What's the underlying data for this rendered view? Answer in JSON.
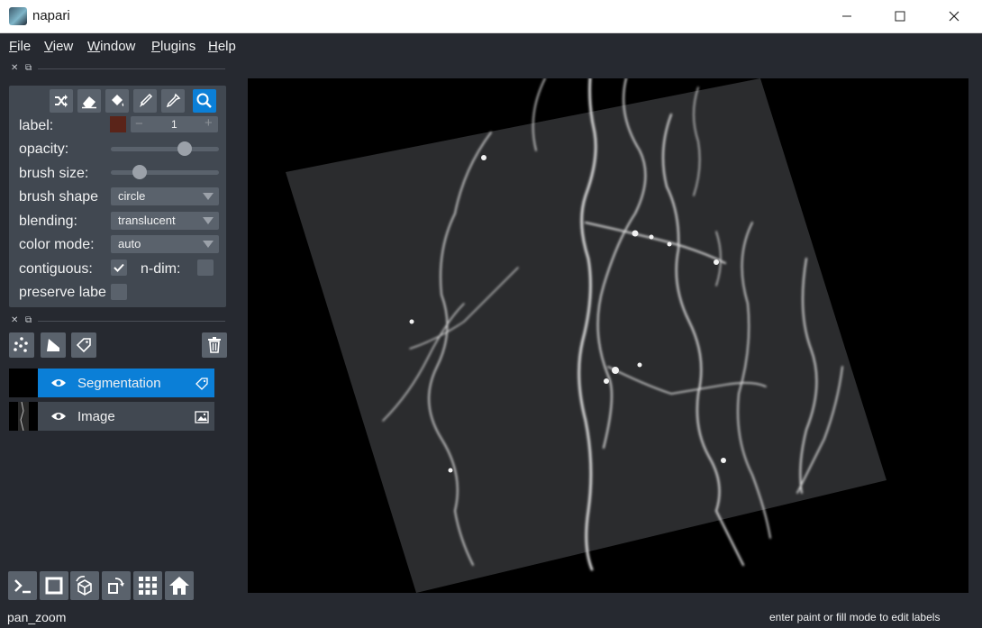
{
  "window": {
    "title": "napari"
  },
  "menu": [
    {
      "first": "F",
      "rest": "ile"
    },
    {
      "first": "V",
      "rest": "iew"
    },
    {
      "first": "W",
      "rest": "indow"
    },
    {
      "first": "P",
      "rest": "lugins"
    },
    {
      "first": "H",
      "rest": "elp"
    }
  ],
  "layer_controls": {
    "label_text": "label:",
    "label_value": "1",
    "label_color": "#5a2419",
    "minus": "−",
    "plus": "+",
    "opacity_text": "opacity:",
    "opacity_value": 0.68,
    "brush_size_text": "brush size:",
    "brush_size_value": 0.27,
    "brush_shape_text": "brush shape",
    "brush_shape_value": "circle",
    "blending_text": "blending:",
    "blending_value": "translucent",
    "color_mode_text": "color mode:",
    "color_mode_value": "auto",
    "contiguous_text": "contiguous:",
    "contiguous_checked": true,
    "ndim_text": "n-dim:",
    "ndim_checked": false,
    "preserve_labels_text": "preserve labe",
    "preserve_labels_checked": false,
    "active_tool": "pan-zoom"
  },
  "layers": [
    {
      "name": "Segmentation",
      "type": "labels",
      "selected": true,
      "visible": true
    },
    {
      "name": "Image",
      "type": "image",
      "selected": false,
      "visible": true
    }
  ],
  "colors": {
    "accent": "#0b7fd7",
    "background": "#262930",
    "panel": "#414851",
    "button": "#5a626c"
  },
  "status": {
    "mode": "pan_zoom",
    "hint": "enter paint or fill mode to edit labels"
  }
}
